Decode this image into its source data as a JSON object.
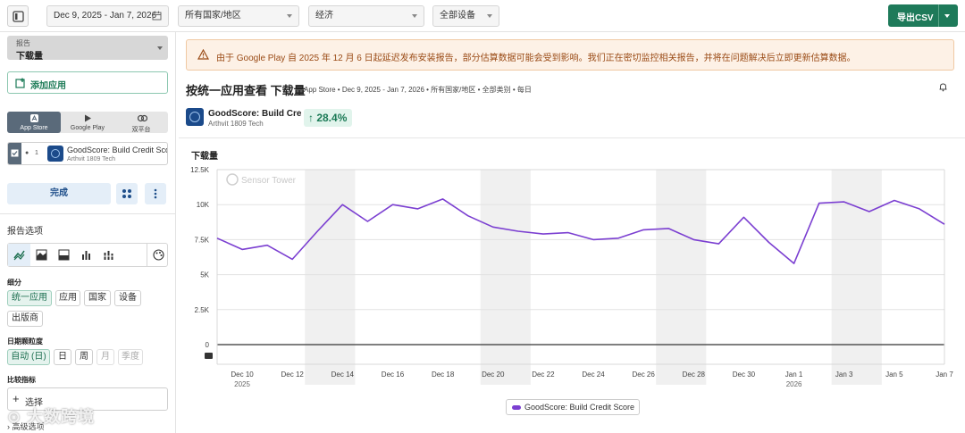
{
  "toolbar": {
    "date_range": "Dec 9, 2025 - Jan 7, 2026",
    "country": "所有国家/地区",
    "category": "经济",
    "device": "全部设备",
    "export_label": "导出CSV"
  },
  "sidebar": {
    "report_small": "报告",
    "report_name": "下载量",
    "add_app": "添加应用",
    "platforms": [
      {
        "label": "App Store",
        "active": true
      },
      {
        "label": "Google Play",
        "active": false
      },
      {
        "label": "双平台",
        "active": false
      }
    ],
    "app": {
      "index": "1",
      "name": "GoodScore: Build Credit Score",
      "publisher": "Arthvit 1809 Tech"
    },
    "done": "完成",
    "report_options": "报告选项",
    "breakdown_label": "细分",
    "breakdown": [
      "统一应用",
      "应用",
      "国家",
      "设备",
      "出版商"
    ],
    "granularity_label": "日期颗粒度",
    "granularity": [
      "自动 (日)",
      "日",
      "周",
      "月",
      "季度"
    ],
    "compare_label": "比较指标",
    "compare_placeholder": "选择",
    "advanced": "高级选项",
    "watermark": "大数跨境"
  },
  "banner": {
    "text": "由于 Google Play 自 2025 年 12 月 6 日起延迟发布安装报告，部分估算数据可能会受到影响。我们正在密切监控相关报告，并将在问题解决后立即更新估算数据。"
  },
  "page": {
    "title": "按统一应用查看 下载量",
    "subtitle": "App Store • Dec 9, 2025 - Jan 7, 2026 • 所有国家/地区 • 全部类别 • 每日"
  },
  "summary": {
    "app_name": "GoodScore: Build Cre…",
    "publisher": "Arthvit 1809 Tech",
    "delta": "↑ 28.4%"
  },
  "chart_data": {
    "type": "line",
    "title": "下载量",
    "watermark": "Sensor Tower",
    "x": [
      "2025-12-09",
      "2025-12-10",
      "2025-12-11",
      "2025-12-12",
      "2025-12-13",
      "2025-12-14",
      "2025-12-15",
      "2025-12-16",
      "2025-12-17",
      "2025-12-18",
      "2025-12-19",
      "2025-12-20",
      "2025-12-21",
      "2025-12-22",
      "2025-12-23",
      "2025-12-24",
      "2025-12-25",
      "2025-12-26",
      "2025-12-27",
      "2025-12-28",
      "2025-12-29",
      "2025-12-30",
      "2025-12-31",
      "2026-01-01",
      "2026-01-02",
      "2026-01-03",
      "2026-01-04",
      "2026-01-05",
      "2026-01-06",
      "2026-01-07"
    ],
    "series": [
      {
        "name": "GoodScore: Build Credit Score",
        "color": "#7b3fd1",
        "values": [
          7600,
          6800,
          7100,
          6100,
          8100,
          10000,
          8800,
          10000,
          9700,
          10400,
          9200,
          8400,
          8100,
          7900,
          8000,
          7500,
          7600,
          8200,
          8300,
          7500,
          7200,
          9100,
          7300,
          5800,
          10100,
          10200,
          9500,
          10300,
          9700,
          8600
        ]
      }
    ],
    "ylim": [
      0,
      12500
    ],
    "yticks": [
      "0",
      "2.5K",
      "5K",
      "7.5K",
      "10K",
      "12.5K"
    ],
    "xtick_labels": [
      {
        "date": "2025-12-10",
        "label": "Dec 10",
        "sub": "2025"
      },
      {
        "date": "2025-12-12",
        "label": "Dec 12",
        "sub": ""
      },
      {
        "date": "2025-12-14",
        "label": "Dec 14",
        "sub": ""
      },
      {
        "date": "2025-12-16",
        "label": "Dec 16",
        "sub": ""
      },
      {
        "date": "2025-12-18",
        "label": "Dec 18",
        "sub": ""
      },
      {
        "date": "2025-12-20",
        "label": "Dec 20",
        "sub": ""
      },
      {
        "date": "2025-12-22",
        "label": "Dec 22",
        "sub": ""
      },
      {
        "date": "2025-12-24",
        "label": "Dec 24",
        "sub": ""
      },
      {
        "date": "2025-12-26",
        "label": "Dec 26",
        "sub": ""
      },
      {
        "date": "2025-12-28",
        "label": "Dec 28",
        "sub": ""
      },
      {
        "date": "2025-12-30",
        "label": "Dec 30",
        "sub": ""
      },
      {
        "date": "2026-01-01",
        "label": "Jan 1",
        "sub": "2026"
      },
      {
        "date": "2026-01-03",
        "label": "Jan 3",
        "sub": ""
      },
      {
        "date": "2026-01-05",
        "label": "Jan 5",
        "sub": ""
      },
      {
        "date": "2026-01-07",
        "label": "Jan 7",
        "sub": ""
      }
    ],
    "weekend_bands": [
      [
        "2025-12-13",
        "2025-12-14"
      ],
      [
        "2025-12-20",
        "2025-12-21"
      ],
      [
        "2025-12-27",
        "2025-12-28"
      ],
      [
        "2026-01-03",
        "2026-01-04"
      ]
    ],
    "grid": true,
    "legend": "bottom-center"
  }
}
